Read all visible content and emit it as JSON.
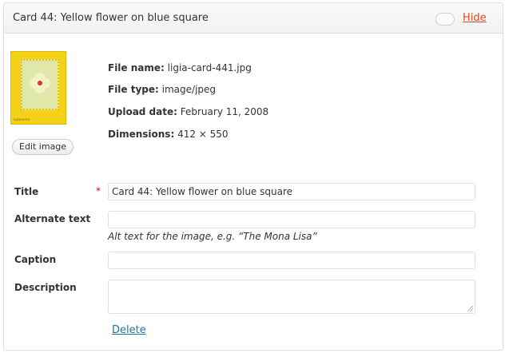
{
  "header": {
    "title": "Card 44: Yellow flower on blue square",
    "hide_label": "Hide"
  },
  "thumbnail": {
    "caption": "ligiaandco"
  },
  "edit_button_label": "Edit image",
  "meta": {
    "file_name_label": "File name:",
    "file_name_value": "ligia-card-441.jpg",
    "file_type_label": "File type:",
    "file_type_value": "image/jpeg",
    "upload_date_label": "Upload date:",
    "upload_date_value": "February 11, 2008",
    "dimensions_label": "Dimensions:",
    "dimensions_value": "412 × 550"
  },
  "form": {
    "title_label": "Title",
    "required_marker": "*",
    "title_value": "Card 44: Yellow flower on blue square",
    "alt_label": "Alternate text",
    "alt_value": "",
    "alt_help": "Alt text for the image, e.g. “The Mona Lisa”",
    "caption_label": "Caption",
    "caption_value": "",
    "description_label": "Description",
    "description_value": ""
  },
  "delete_label": "Delete",
  "colors": {
    "link_hide": "#d54e21",
    "link_delete": "#21759b",
    "required": "#dd0000",
    "thumb_yellow": "#f5d21a"
  }
}
